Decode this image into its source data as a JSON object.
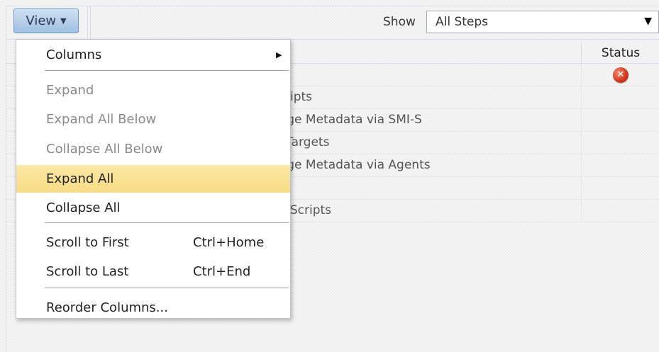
{
  "toolbar": {
    "view_label": "View",
    "show_label": "Show",
    "show_value": "All Steps"
  },
  "table": {
    "status_header": "Status",
    "rows": [
      {
        "name": "",
        "status_icon": "error-icon"
      },
      {
        "name": "nt Scripts"
      },
      {
        "name": "Storage Metadata via SMI-S"
      },
      {
        "name": "With Targets"
      },
      {
        "name": "Storage Metadata via Agents"
      },
      {
        "name": ""
      },
      {
        "name": "ment Scripts"
      }
    ]
  },
  "menu": {
    "items": [
      {
        "label": "Columns",
        "shortcut": "",
        "state": "enabled",
        "submenu": true
      },
      {
        "label": "Expand",
        "shortcut": "",
        "state": "disabled"
      },
      {
        "label": "Expand All Below",
        "shortcut": "",
        "state": "disabled"
      },
      {
        "label": "Collapse All Below",
        "shortcut": "",
        "state": "disabled"
      },
      {
        "label": "Expand All",
        "shortcut": "",
        "state": "highlighted"
      },
      {
        "label": "Collapse All",
        "shortcut": "",
        "state": "enabled"
      },
      {
        "label": "Scroll to First",
        "shortcut": "Ctrl+Home",
        "state": "enabled"
      },
      {
        "label": "Scroll to Last",
        "shortcut": "Ctrl+End",
        "state": "enabled"
      },
      {
        "label": "Reorder Columns...",
        "shortcut": "",
        "state": "enabled"
      }
    ]
  },
  "colors": {
    "highlight": "#f9e08f",
    "button": "#b4d0ec",
    "error": "#d0341b"
  }
}
